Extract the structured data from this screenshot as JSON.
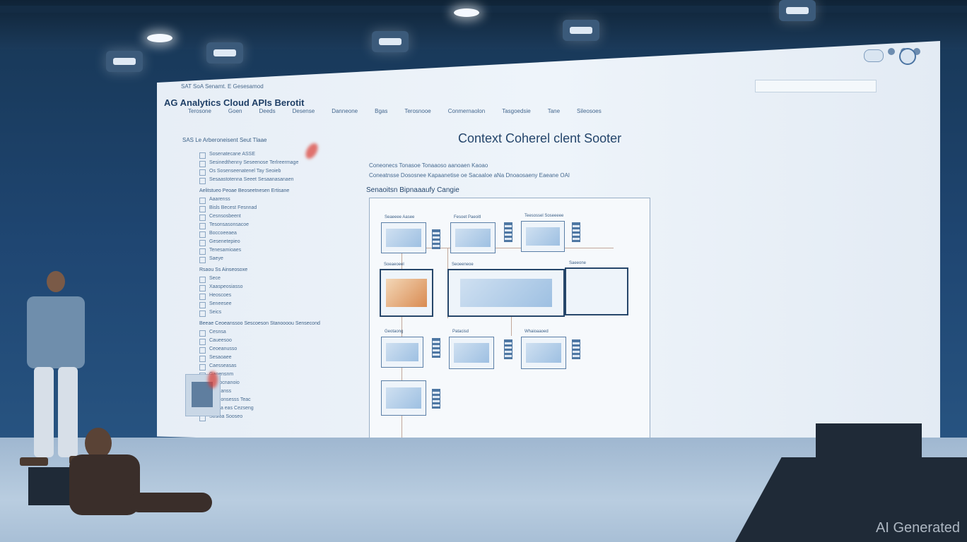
{
  "screen": {
    "url": "SAT SoA Senamt. E Gesesamod",
    "app_title": "AG Analytics Cloud APIs Berotit",
    "nav_tabs": [
      "Terosone",
      "Goen",
      "Deeds",
      "Desense",
      "Danneone",
      "Bgas",
      "Terosnooe",
      "Conmernaolon",
      "Tasgoedsie",
      "Tane",
      "Sileosoes"
    ],
    "tree_header": "SAS Le Arberoneisent Seut Tlaae",
    "tree_items": [
      "Sosenatecane ASSE",
      "Sesinedthenny Seseenose Terlreermage",
      "Os Sosenseenatenel Tay Seoieb",
      "Sesaastotenna Seeet Sesaanasanaen",
      "Aelitstueo Peoae Beoseetnesen Ertisane",
      "Aaarenss",
      "Bisls Becest Fesnnad",
      "Cesnsosbeent",
      "Tesonsasonsacoe",
      "Boccoeeaea",
      "Gesenetepieo",
      "Tenesamioaes",
      "Saeye",
      "Rsaou Ss Ainseosoxe",
      "Sece",
      "Xaaspeosiasso",
      "Heoscoes",
      "Seneesee",
      "Seics",
      "Beeae Ceoeanssoo Sescoeson Stanoooou Sensecond",
      "Cesnsa",
      "Caueesoo",
      "Ceoeanusso",
      "Sesaoaee",
      "Caesseasas",
      "Ganensnm",
      "Cnleocnanoio",
      "Seeeanss",
      "Gesconsesss Teac",
      "Bseaa eas Cezseng",
      "Sosioa Sooseo"
    ],
    "doc_title": "Context Coherel clent Sooter",
    "doc_lines": [
      "Coneonecs  Tonasoe Tonaaoso aanoaen Kaoao",
      "Coneatnsse  Dososnee  Kapaanetise oe Sacaaloe aNa Dnoaosaeny Eaeane OAl"
    ],
    "diagram_title": "Senaoitsn Bipnaaaufy Cangie",
    "diagram_labels": [
      "Seaeeee Aasee",
      "Fesoet Paeoitl",
      "Teesossel Soseeeee",
      "Soeaeoeel",
      "Seoeeneoe",
      "Saeeone",
      "Geotaong",
      "Patacisd",
      "Whaioaaoed"
    ],
    "colors": {
      "screen": "#eef4fa",
      "accent": "#2f4f72",
      "stage": "#b9cde0"
    }
  },
  "watermark": "AI Generated"
}
